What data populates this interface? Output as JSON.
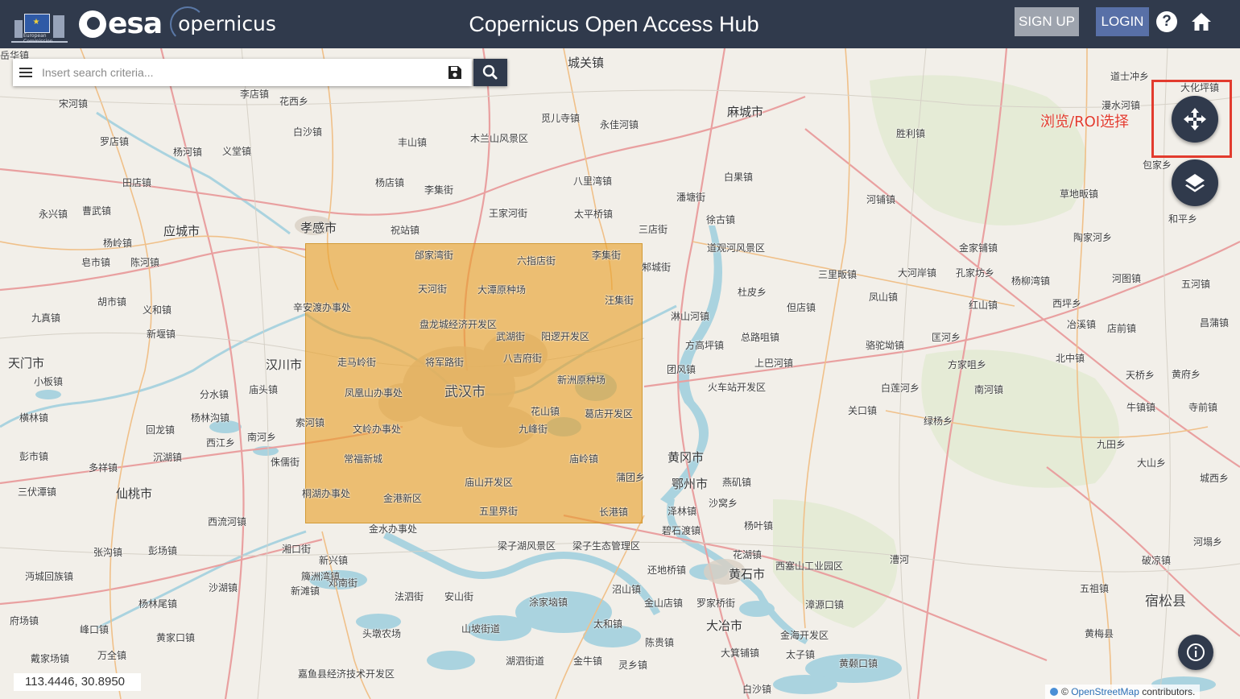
{
  "header": {
    "eu_caption": "European Commission",
    "esa_logo": "esa",
    "copernicus_logo": "opernicus",
    "title": "Copernicus Open Access Hub",
    "signup_label": "SIGN UP",
    "login_label": "LOGIN",
    "help_icon": "?",
    "home_icon": "home-icon"
  },
  "search": {
    "placeholder": "Insert search criteria...",
    "value": "",
    "menu_icon": "menu-icon",
    "save_icon": "save-icon",
    "search_icon": "search-icon"
  },
  "map": {
    "annotation": "浏览/ROI选择",
    "pan_icon": "move-arrows-icon",
    "layers_icon": "layers-icon",
    "info_icon": "info-icon",
    "coordinates": "113.4446, 30.8950",
    "attribution_prefix": "©",
    "attribution_link": "OpenStreetMap",
    "attribution_suffix": "contributors.",
    "roi_color": "#e8a028",
    "accent": "#303a4c",
    "places": [
      {
        "name": "宋河镇"
      },
      {
        "name": "罗店镇"
      },
      {
        "name": "杨河镇"
      },
      {
        "name": "义堂镇"
      },
      {
        "name": "田店镇"
      },
      {
        "name": "曹武镇"
      },
      {
        "name": "永兴镇"
      },
      {
        "name": "应城市"
      },
      {
        "name": "杨岭镇"
      },
      {
        "name": "皂市镇"
      },
      {
        "name": "陈河镇"
      },
      {
        "name": "胡市镇"
      },
      {
        "name": "义和镇"
      },
      {
        "name": "九真镇"
      },
      {
        "name": "新堰镇"
      },
      {
        "name": "天门市"
      },
      {
        "name": "小板镇"
      },
      {
        "name": "汉川市"
      },
      {
        "name": "分水镇"
      },
      {
        "name": "庙头镇"
      },
      {
        "name": "横林镇"
      },
      {
        "name": "杨林沟镇"
      },
      {
        "name": "回龙镇"
      },
      {
        "name": "西江乡"
      },
      {
        "name": "南河乡"
      },
      {
        "name": "彭市镇"
      },
      {
        "name": "多祥镇"
      },
      {
        "name": "沉湖镇"
      },
      {
        "name": "三伏潭镇"
      },
      {
        "name": "仙桃市"
      },
      {
        "name": "西流河镇"
      },
      {
        "name": "张沟镇"
      },
      {
        "name": "彭场镇"
      },
      {
        "name": "沔城回族镇"
      },
      {
        "name": "沙湖镇"
      },
      {
        "name": "杨林尾镇"
      },
      {
        "name": "府场镇"
      },
      {
        "name": "峰口镇"
      },
      {
        "name": "黄家口镇"
      },
      {
        "name": "戴家场镇"
      },
      {
        "name": "万全镇"
      },
      {
        "name": "花西乡"
      },
      {
        "name": "李店镇"
      },
      {
        "name": "白沙镇"
      },
      {
        "name": "丰山镇"
      },
      {
        "name": "杨店镇"
      },
      {
        "name": "李集街"
      },
      {
        "name": "孝感市"
      },
      {
        "name": "祝站镇"
      },
      {
        "name": "王家河街"
      },
      {
        "name": "木兰山风景区"
      },
      {
        "name": "城关镇"
      },
      {
        "name": "觅儿寺镇"
      },
      {
        "name": "永佳河镇"
      },
      {
        "name": "八里湾镇"
      },
      {
        "name": "太平桥镇"
      },
      {
        "name": "麻城市"
      },
      {
        "name": "白果镇"
      },
      {
        "name": "潘塘街"
      },
      {
        "name": "徐古镇"
      },
      {
        "name": "三店街"
      },
      {
        "name": "道观河风景区"
      },
      {
        "name": "邾城街"
      },
      {
        "name": "杜皮乡"
      },
      {
        "name": "淋山河镇"
      },
      {
        "name": "但店镇"
      },
      {
        "name": "方高坪镇"
      },
      {
        "name": "总路咀镇"
      },
      {
        "name": "上巴河镇"
      },
      {
        "name": "团风镇"
      },
      {
        "name": "火车站开发区"
      },
      {
        "name": "黄冈市"
      },
      {
        "name": "鄂州市"
      },
      {
        "name": "燕矶镇"
      },
      {
        "name": "泽林镇"
      },
      {
        "name": "沙窝乡"
      },
      {
        "name": "碧石渡镇"
      },
      {
        "name": "杨叶镇"
      },
      {
        "name": "花湖镇"
      },
      {
        "name": "西塞山工业园区"
      },
      {
        "name": "黄石市"
      },
      {
        "name": "还地桥镇"
      },
      {
        "name": "罗家桥街"
      },
      {
        "name": "金山店镇"
      },
      {
        "name": "大冶市"
      },
      {
        "name": "漳源口镇"
      },
      {
        "name": "金海开发区"
      },
      {
        "name": "陈贵镇"
      },
      {
        "name": "大箕铺镇"
      },
      {
        "name": "太子镇"
      },
      {
        "name": "黄颡口镇"
      },
      {
        "name": "白沙镇"
      },
      {
        "name": "胜利镇"
      },
      {
        "name": "漫水河镇"
      },
      {
        "name": "道士冲乡"
      },
      {
        "name": "河铺镇"
      },
      {
        "name": "草地畈镇"
      },
      {
        "name": "陶家河乡"
      },
      {
        "name": "金家铺镇"
      },
      {
        "name": "三里畈镇"
      },
      {
        "name": "大河岸镇"
      },
      {
        "name": "孔家坊乡"
      },
      {
        "name": "杨柳湾镇"
      },
      {
        "name": "河图镇"
      },
      {
        "name": "五河镇"
      },
      {
        "name": "凤山镇"
      },
      {
        "name": "红山镇"
      },
      {
        "name": "西坪乡"
      },
      {
        "name": "冶溪镇"
      },
      {
        "name": "店前镇"
      },
      {
        "name": "昌蒲镇"
      },
      {
        "name": "骆驼坳镇"
      },
      {
        "name": "匡河乡"
      },
      {
        "name": "方家咀乡"
      },
      {
        "name": "北中镇"
      },
      {
        "name": "天桥乡"
      },
      {
        "name": "黄府乡"
      },
      {
        "name": "白莲河乡"
      },
      {
        "name": "南河镇"
      },
      {
        "name": "关口镇"
      },
      {
        "name": "绿杨乡"
      },
      {
        "name": "牛镇镇"
      },
      {
        "name": "寺前镇"
      },
      {
        "name": "九田乡"
      },
      {
        "name": "大山乡"
      },
      {
        "name": "城西乡"
      },
      {
        "name": "河塌乡"
      },
      {
        "name": "破凉镇"
      },
      {
        "name": "五祖镇"
      },
      {
        "name": "宿松县"
      },
      {
        "name": "黄梅县"
      },
      {
        "name": "漕河"
      },
      {
        "name": "和平乡"
      },
      {
        "name": "包家乡"
      },
      {
        "name": "大化坪镇"
      },
      {
        "name": "湘口街"
      },
      {
        "name": "新滩镇"
      },
      {
        "name": "法泗街"
      },
      {
        "name": "安山街"
      },
      {
        "name": "梁子湖风景区"
      },
      {
        "name": "梁子生态管理区"
      },
      {
        "name": "沼山镇"
      },
      {
        "name": "涂家垴镇"
      },
      {
        "name": "太和镇"
      },
      {
        "name": "山坡街道"
      },
      {
        "name": "湖泗街道"
      },
      {
        "name": "金牛镇"
      },
      {
        "name": "灵乡镇"
      },
      {
        "name": "头墩农场"
      },
      {
        "name": "嘉鱼县经济技术开发区"
      },
      {
        "name": "簰洲湾镇"
      },
      {
        "name": "邓南街"
      },
      {
        "name": "金水办事处"
      },
      {
        "name": "辛安渡办事处"
      },
      {
        "name": "索河镇"
      },
      {
        "name": "侏儒街"
      },
      {
        "name": "新兴镇"
      },
      {
        "name": "岳华镇"
      }
    ],
    "roi_places": [
      {
        "name": "邰家湾街"
      },
      {
        "name": "六指店街"
      },
      {
        "name": "李集街"
      },
      {
        "name": "天河街"
      },
      {
        "name": "大潭原种场"
      },
      {
        "name": "汪集街"
      },
      {
        "name": "盘龙城经济开发区"
      },
      {
        "name": "武湖街"
      },
      {
        "name": "阳逻开发区"
      },
      {
        "name": "走马岭街"
      },
      {
        "name": "将军路街"
      },
      {
        "name": "八吉府街"
      },
      {
        "name": "新洲原种场"
      },
      {
        "name": "凤凰山办事处"
      },
      {
        "name": "武汉市"
      },
      {
        "name": "文岭办事处"
      },
      {
        "name": "花山镇"
      },
      {
        "name": "葛店开发区"
      },
      {
        "name": "九峰街"
      },
      {
        "name": "常福新城"
      },
      {
        "name": "庙岭镇"
      },
      {
        "name": "蒲团乡"
      },
      {
        "name": "庙山开发区"
      },
      {
        "name": "桐湖办事处"
      },
      {
        "name": "金港新区"
      },
      {
        "name": "五里界街"
      },
      {
        "name": "长港镇"
      }
    ]
  }
}
